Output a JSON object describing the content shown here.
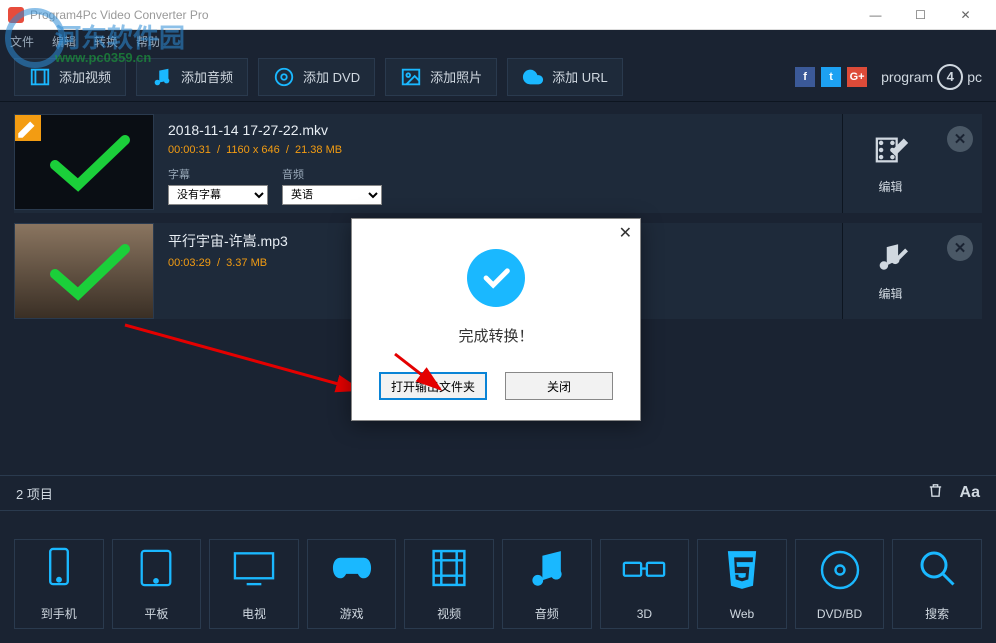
{
  "window": {
    "title": "Program4Pc Video Converter Pro"
  },
  "watermark": {
    "text1": "河东软件园",
    "text2": "www.pc0359.cn"
  },
  "menu": {
    "file": "文件",
    "edit": "编辑",
    "convert": "转换",
    "help": "帮助"
  },
  "toolbar": {
    "add_video": "添加视频",
    "add_audio": "添加音频",
    "add_dvd": "添加 DVD",
    "add_photo": "添加照片",
    "add_url": "添加 URL",
    "brand": "program",
    "brand_suffix": "pc",
    "brand_num": "4"
  },
  "files": [
    {
      "name": "2018-11-14 17-27-22.mkv",
      "duration": "00:00:31",
      "resolution": "1160 x 646",
      "size": "21.38 MB",
      "subtitle_label": "字幕",
      "subtitle_value": "没有字幕",
      "audio_label": "音频",
      "audio_value": "英语",
      "edit": "编辑"
    },
    {
      "name": "平行宇宙-许嵩.mp3",
      "duration": "00:03:29",
      "size": "3.37 MB",
      "edit": "编辑"
    }
  ],
  "status": {
    "count": "2 项目"
  },
  "dock": {
    "phone": "到手机",
    "tablet": "平板",
    "tv": "电视",
    "game": "游戏",
    "video": "视频",
    "audio": "音频",
    "threed": "3D",
    "web": "Web",
    "dvd": "DVD/BD",
    "search": "搜索"
  },
  "dialog": {
    "message": "完成转换！",
    "open_folder": "打开输出文件夹",
    "close": "关闭"
  }
}
